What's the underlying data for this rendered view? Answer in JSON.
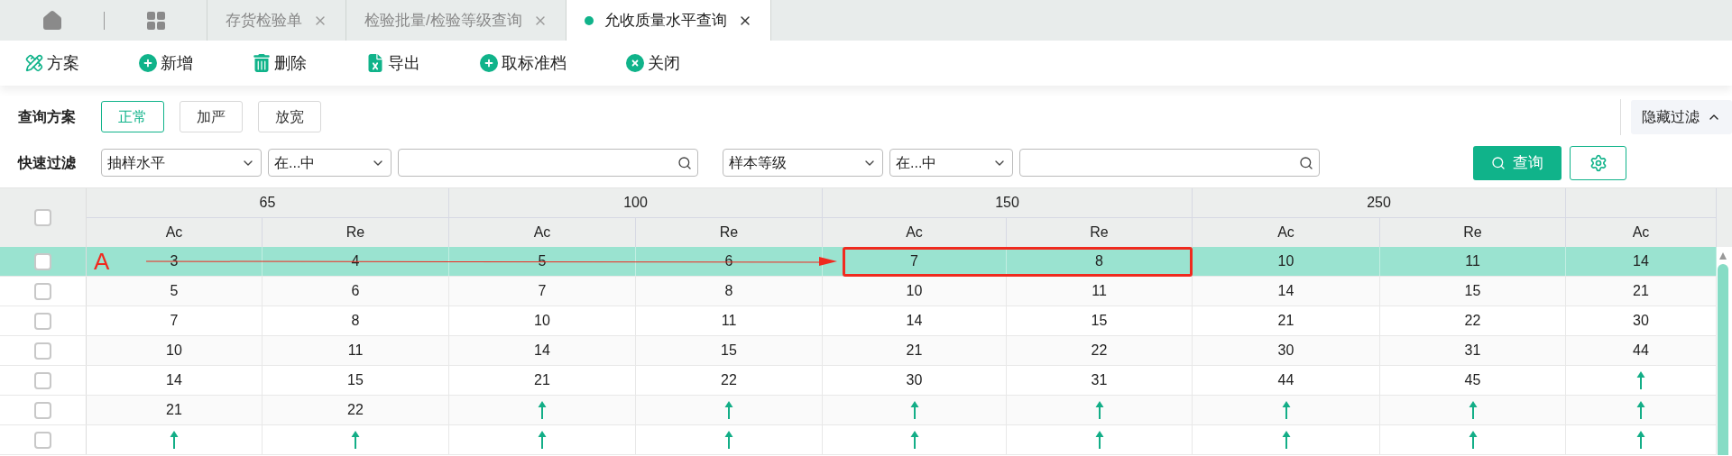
{
  "tabs": [
    {
      "label": "存货检验单",
      "selected": false
    },
    {
      "label": "检验批量/检验等级查询",
      "selected": false
    },
    {
      "label": "允收质量水平查询",
      "selected": true
    }
  ],
  "toolbar": [
    {
      "kind": "scheme",
      "label": "方案"
    },
    {
      "kind": "add",
      "label": "新增"
    },
    {
      "kind": "delete",
      "label": "删除"
    },
    {
      "kind": "export",
      "label": "导出"
    },
    {
      "kind": "add",
      "label": "取标准档"
    },
    {
      "kind": "close",
      "label": "关闭"
    }
  ],
  "query_scheme": {
    "label": "查询方案",
    "options": [
      {
        "label": "正常",
        "selected": true
      },
      {
        "label": "加严",
        "selected": false
      },
      {
        "label": "放宽",
        "selected": false
      }
    ]
  },
  "hide_filter": {
    "label": "隐藏过滤"
  },
  "quick_filter": {
    "label": "快速过滤",
    "filters": [
      {
        "field": "抽样水平",
        "operator": "在...中"
      },
      {
        "field": "样本等级",
        "operator": "在...中"
      }
    ]
  },
  "query_button": {
    "label": "查询"
  },
  "table": {
    "header_checked": false,
    "groups": [
      "65",
      "100",
      "150",
      "250"
    ],
    "columns": [
      "Ac",
      "Re",
      "Ac",
      "Re",
      "Ac",
      "Re",
      "Ac",
      "Re",
      "Ac"
    ],
    "rows": [
      {
        "selected": true,
        "checked": false,
        "cells": [
          {
            "kind": "text",
            "text": "3",
            "boxed": false
          },
          {
            "kind": "text",
            "text": "4",
            "boxed": false
          },
          {
            "kind": "text",
            "text": "5",
            "boxed": false
          },
          {
            "kind": "text",
            "text": "6",
            "boxed": false
          },
          {
            "kind": "text",
            "text": "7",
            "boxed": true
          },
          {
            "kind": "text",
            "text": "8",
            "boxed": true
          },
          {
            "kind": "text",
            "text": "10",
            "boxed": false
          },
          {
            "kind": "text",
            "text": "11",
            "boxed": false
          },
          {
            "kind": "text",
            "text": "14",
            "boxed": false
          }
        ]
      },
      {
        "selected": false,
        "checked": false,
        "cells": [
          {
            "kind": "text",
            "text": "5"
          },
          {
            "kind": "text",
            "text": "6"
          },
          {
            "kind": "text",
            "text": "7"
          },
          {
            "kind": "text",
            "text": "8"
          },
          {
            "kind": "text",
            "text": "10"
          },
          {
            "kind": "text",
            "text": "11"
          },
          {
            "kind": "text",
            "text": "14"
          },
          {
            "kind": "text",
            "text": "15"
          },
          {
            "kind": "text",
            "text": "21"
          }
        ]
      },
      {
        "selected": false,
        "checked": false,
        "cells": [
          {
            "kind": "text",
            "text": "7"
          },
          {
            "kind": "text",
            "text": "8"
          },
          {
            "kind": "text",
            "text": "10"
          },
          {
            "kind": "text",
            "text": "11"
          },
          {
            "kind": "text",
            "text": "14"
          },
          {
            "kind": "text",
            "text": "15"
          },
          {
            "kind": "text",
            "text": "21"
          },
          {
            "kind": "text",
            "text": "22"
          },
          {
            "kind": "text",
            "text": "30"
          }
        ]
      },
      {
        "selected": false,
        "checked": false,
        "cells": [
          {
            "kind": "text",
            "text": "10"
          },
          {
            "kind": "text",
            "text": "11"
          },
          {
            "kind": "text",
            "text": "14"
          },
          {
            "kind": "text",
            "text": "15"
          },
          {
            "kind": "text",
            "text": "21"
          },
          {
            "kind": "text",
            "text": "22"
          },
          {
            "kind": "text",
            "text": "30"
          },
          {
            "kind": "text",
            "text": "31"
          },
          {
            "kind": "text",
            "text": "44"
          }
        ]
      },
      {
        "selected": false,
        "checked": false,
        "cells": [
          {
            "kind": "text",
            "text": "14"
          },
          {
            "kind": "text",
            "text": "15"
          },
          {
            "kind": "text",
            "text": "21"
          },
          {
            "kind": "text",
            "text": "22"
          },
          {
            "kind": "text",
            "text": "30"
          },
          {
            "kind": "text",
            "text": "31"
          },
          {
            "kind": "text",
            "text": "44"
          },
          {
            "kind": "text",
            "text": "45"
          },
          {
            "kind": "arrow"
          }
        ]
      },
      {
        "selected": false,
        "checked": false,
        "cells": [
          {
            "kind": "text",
            "text": "21"
          },
          {
            "kind": "text",
            "text": "22"
          },
          {
            "kind": "arrow"
          },
          {
            "kind": "arrow"
          },
          {
            "kind": "arrow"
          },
          {
            "kind": "arrow"
          },
          {
            "kind": "arrow"
          },
          {
            "kind": "arrow"
          },
          {
            "kind": "arrow"
          }
        ]
      },
      {
        "selected": false,
        "checked": false,
        "cells": [
          {
            "kind": "arrow"
          },
          {
            "kind": "arrow"
          },
          {
            "kind": "arrow"
          },
          {
            "kind": "arrow"
          },
          {
            "kind": "arrow"
          },
          {
            "kind": "arrow"
          },
          {
            "kind": "arrow"
          },
          {
            "kind": "arrow"
          },
          {
            "kind": "arrow"
          }
        ]
      }
    ]
  },
  "annotation": {
    "label": "A"
  }
}
